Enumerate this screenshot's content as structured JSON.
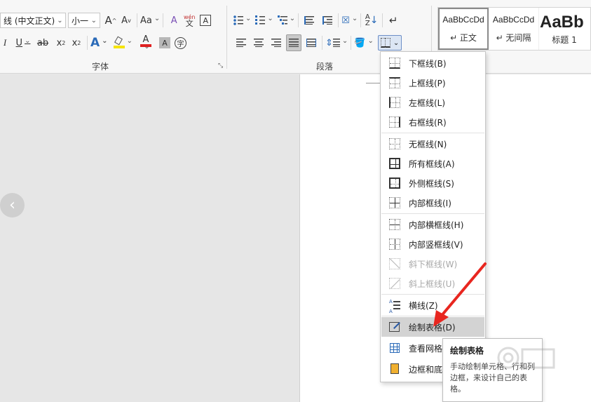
{
  "ribbon": {
    "font_name": "线 (中文正文)",
    "font_size": "小一",
    "groups": {
      "font": "字体",
      "paragraph": "段落"
    },
    "buttons": {
      "grow_font": "A",
      "shrink_font": "A",
      "change_case": "Aa",
      "clear_format": "A",
      "phonetic": "wén",
      "phonetic_sub": "文",
      "char_border": "A",
      "italic": "I",
      "underline": "U",
      "strike": "ab",
      "subscript": "x",
      "superscript": "x",
      "text_effect": "A",
      "font_color": "A",
      "char_shading": "A",
      "enclose": "字"
    }
  },
  "styles": [
    {
      "sample": "AaBbCcDd",
      "name": "↵ 正文"
    },
    {
      "sample": "AaBbCcDd",
      "name": "↵ 无间隔"
    },
    {
      "sample": "AaBb",
      "name": "标题 1"
    }
  ],
  "menu": {
    "items": [
      {
        "label": "下框线(B)",
        "icon": "border-bottom-icon"
      },
      {
        "label": "上框线(P)",
        "icon": "border-top-icon"
      },
      {
        "label": "左框线(L)",
        "icon": "border-left-icon"
      },
      {
        "label": "右框线(R)",
        "icon": "border-right-icon"
      },
      {
        "label": "无框线(N)",
        "icon": "border-none-icon"
      },
      {
        "label": "所有框线(A)",
        "icon": "border-all-icon"
      },
      {
        "label": "外侧框线(S)",
        "icon": "border-outside-icon"
      },
      {
        "label": "内部框线(I)",
        "icon": "border-inside-icon"
      },
      {
        "label": "内部横框线(H)",
        "icon": "border-inside-horizontal-icon"
      },
      {
        "label": "内部竖框线(V)",
        "icon": "border-inside-vertical-icon"
      },
      {
        "label": "斜下框线(W)",
        "icon": "diagonal-down-icon"
      },
      {
        "label": "斜上框线(U)",
        "icon": "diagonal-up-icon"
      },
      {
        "label": "横线(Z)",
        "icon": "horizontal-line-icon"
      },
      {
        "label": "绘制表格(D)",
        "icon": "draw-table-icon"
      },
      {
        "label": "查看网格",
        "icon": "view-gridlines-icon"
      },
      {
        "label": "边框和底",
        "icon": "borders-shading-icon"
      }
    ]
  },
  "tooltip": {
    "title": "绘制表格",
    "body": "手动绘制单元格、行和列边框，来设计自己的表格。"
  },
  "colors": {
    "highlight": "#f5e400",
    "font_color": "#e02020",
    "arrow": "#e8261f",
    "selection": "#d3d3d3"
  }
}
